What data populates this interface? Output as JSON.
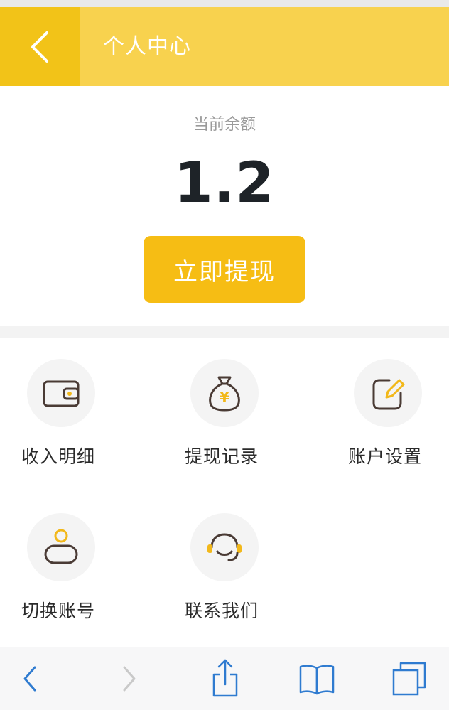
{
  "header": {
    "title": "个人中心",
    "back_icon": "chevron-left-icon"
  },
  "balance": {
    "label": "当前余额",
    "value": "1.2"
  },
  "withdraw_button": {
    "label": "立即提现"
  },
  "menu": [
    {
      "label": "收入明细",
      "icon": "wallet-icon"
    },
    {
      "label": "提现记录",
      "icon": "money-bag-icon"
    },
    {
      "label": "账户设置",
      "icon": "edit-icon"
    },
    {
      "label": "切换账号",
      "icon": "user-icon"
    },
    {
      "label": "联系我们",
      "icon": "headset-icon"
    }
  ],
  "browser_toolbar": {
    "icons": [
      "back-icon",
      "forward-icon",
      "share-icon",
      "bookmarks-icon",
      "tabs-icon"
    ]
  },
  "colors": {
    "header_bg": "#f8d24e",
    "back_box_bg": "#f2c318",
    "accent": "#f6bd14",
    "icon_stroke": "#4a3b35",
    "icon_accent": "#f2b81a",
    "browser_blue": "#2f7bd0"
  }
}
